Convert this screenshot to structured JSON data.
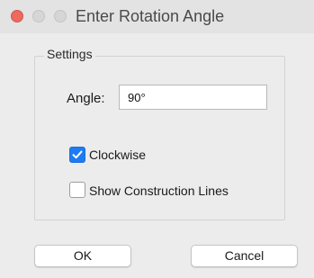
{
  "window": {
    "title": "Enter Rotation Angle",
    "controls": [
      "close-button",
      "minimize-button",
      "zoom-button"
    ]
  },
  "settings": {
    "group_label": "Settings",
    "angle_label": "Angle:",
    "angle_value": "90°",
    "clockwise": {
      "label": "Clockwise",
      "checked": true
    },
    "construction_lines": {
      "label": "Show Construction Lines",
      "checked": false
    }
  },
  "buttons": {
    "ok_label": "OK",
    "cancel_label": "Cancel"
  },
  "colors": {
    "close_red": "#ed6a5e",
    "checkbox_blue": "#1f7bf0",
    "window_bg": "#ececec"
  },
  "icons": {
    "checkmark": "check-icon"
  }
}
